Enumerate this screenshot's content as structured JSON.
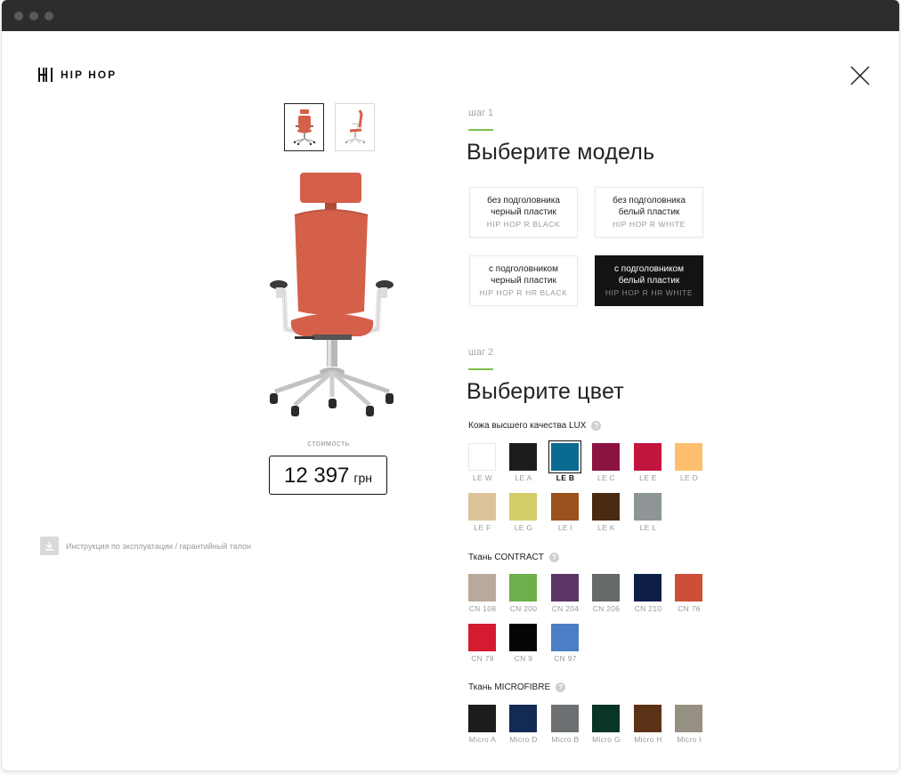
{
  "brand": {
    "name": "HIP HOP"
  },
  "price": {
    "label": "стоимость",
    "value": "12 397",
    "currency": "грн"
  },
  "manual": {
    "text": "Инструкция по эксплуатации / гарантийный талон"
  },
  "step1": {
    "label": "шаг 1",
    "title": "Выберите модель",
    "models": [
      {
        "line1": "без подголовника",
        "line2": "черный пластик",
        "code": "HIP HOP R BLACK",
        "selected": false
      },
      {
        "line1": "без подголовника",
        "line2": "белый пластик",
        "code": "HIP HOP R WHITE",
        "selected": false
      },
      {
        "line1": "с подголовником",
        "line2": "черный пластик",
        "code": "HIP HOP R HR BLACK",
        "selected": false
      },
      {
        "line1": "с подголовником",
        "line2": "белый пластик",
        "code": "HIP HOP R HR WHITE",
        "selected": true
      }
    ]
  },
  "step2": {
    "label": "шаг 2",
    "title": "Выберите цвет",
    "help_glyph": "?",
    "categories": [
      {
        "name": "Кожа высшего качества LUX",
        "swatches": [
          {
            "code": "LE W",
            "color": "#ffffff"
          },
          {
            "code": "LE A",
            "color": "#1b1d1c"
          },
          {
            "code": "LE B",
            "color": "#0b6a8f",
            "selected": true
          },
          {
            "code": "LE C",
            "color": "#8a1342"
          },
          {
            "code": "LE E",
            "color": "#c2153e"
          },
          {
            "code": "LE D",
            "color": "#fdbf6e"
          },
          {
            "code": "LE F",
            "color": "#dcc49a"
          },
          {
            "code": "LE G",
            "color": "#d3cd6a"
          },
          {
            "code": "LE I",
            "color": "#9a531d"
          },
          {
            "code": "LE K",
            "color": "#4b2a12"
          },
          {
            "code": "LE L",
            "color": "#8f9496"
          }
        ]
      },
      {
        "name": "Ткань CONTRACT",
        "swatches": [
          {
            "code": "CN 108",
            "color": "#b7aa9b"
          },
          {
            "code": "CN 200",
            "color": "#6caf4b"
          },
          {
            "code": "CN 204",
            "color": "#5b3667"
          },
          {
            "code": "CN 206",
            "color": "#656a6a"
          },
          {
            "code": "CN 210",
            "color": "#0f2048"
          },
          {
            "code": "CN 76",
            "color": "#cf4e38"
          },
          {
            "code": "CN 79",
            "color": "#d51b30"
          },
          {
            "code": "CN 9",
            "color": "#050505"
          },
          {
            "code": "CN 97",
            "color": "#4a7fc6"
          }
        ]
      },
      {
        "name": "Ткань MICROFIBRE",
        "swatches": [
          {
            "code": "Micro A",
            "color": "#1b1c1c"
          },
          {
            "code": "Micro D",
            "color": "#122a54"
          },
          {
            "code": "Micro B",
            "color": "#6d7072"
          },
          {
            "code": "Micro G",
            "color": "#093524"
          },
          {
            "code": "Micro H",
            "color": "#5c3216"
          },
          {
            "code": "Micro I",
            "color": "#969082"
          }
        ]
      }
    ]
  },
  "accent_color": "#7cbf4a",
  "chair_color": "#d4604a"
}
